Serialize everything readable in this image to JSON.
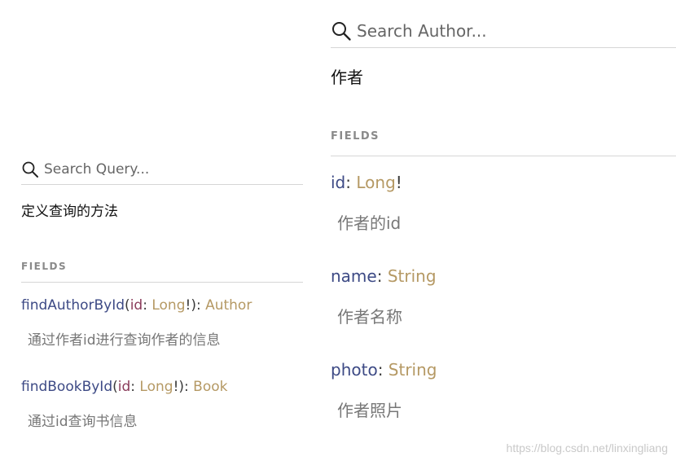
{
  "left": {
    "search": {
      "placeholder": "Search Query..."
    },
    "description": "定义查询的方法",
    "fields_heading": "FIELDS",
    "fields": [
      {
        "name": "findAuthorById",
        "open": "(",
        "arg": "id",
        "colon": ": ",
        "arg_type": "Long",
        "bang": "!",
        "close": "): ",
        "return_type": "Author",
        "description": "通过作者id进行查询作者的信息"
      },
      {
        "name": "findBookById",
        "open": "(",
        "arg": "id",
        "colon": ": ",
        "arg_type": "Long",
        "bang": "!",
        "close": "): ",
        "return_type": "Book",
        "description": "通过id查询书信息"
      }
    ]
  },
  "right": {
    "search": {
      "placeholder": "Search Author..."
    },
    "description": "作者",
    "fields_heading": "FIELDS",
    "fields": [
      {
        "name": "id",
        "colon": ": ",
        "type": "Long",
        "bang": "!",
        "description": "作者的id"
      },
      {
        "name": "name",
        "colon": ": ",
        "type": "String",
        "bang": "",
        "description": "作者名称"
      },
      {
        "name": "photo",
        "colon": ": ",
        "type": "String",
        "bang": "",
        "description": "作者照片"
      }
    ]
  },
  "watermark": "https://blog.csdn.net/linxingliang",
  "icons": {
    "search": "search-icon"
  },
  "colors": {
    "field_name": "#3d4a85",
    "argument": "#8a3b5a",
    "type": "#b59964",
    "heading": "#8a8a8a",
    "divider": "#d6d6d6",
    "description": "#777777"
  }
}
